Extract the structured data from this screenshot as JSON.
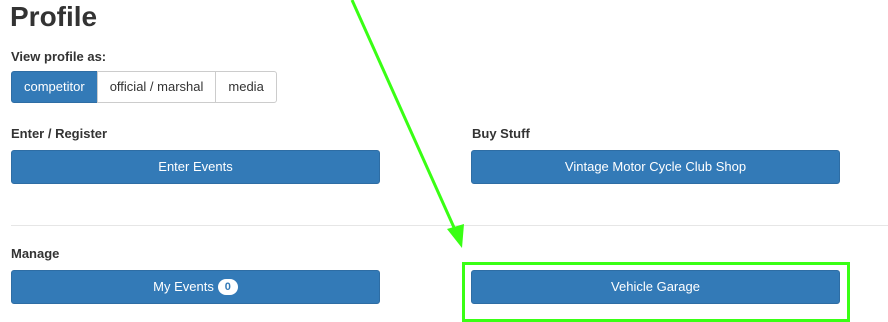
{
  "page": {
    "title": "Profile"
  },
  "view_profile": {
    "label": "View profile as:",
    "options": [
      "competitor",
      "official / marshal",
      "media"
    ],
    "selected": "competitor"
  },
  "enter_register": {
    "label": "Enter / Register",
    "button": "Enter Events"
  },
  "buy_stuff": {
    "label": "Buy Stuff",
    "button": "Vintage Motor Cycle Club Shop"
  },
  "manage": {
    "label": "Manage",
    "my_events": {
      "label": "My Events",
      "count": "0"
    },
    "vehicle_garage": "Vehicle Garage"
  },
  "colors": {
    "primary": "#337ab7",
    "annotation": "#39ff14"
  }
}
